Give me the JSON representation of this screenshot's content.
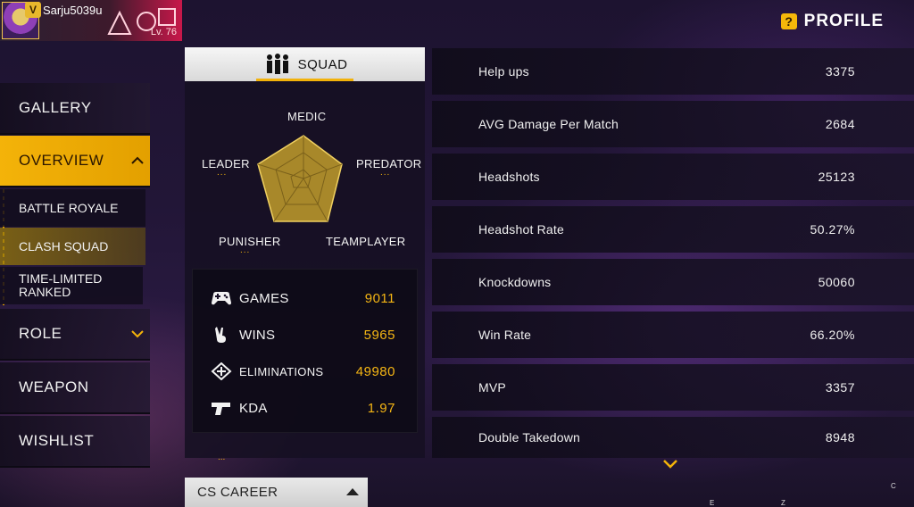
{
  "player": {
    "rank_badge": "V",
    "name": "Sarju5039u",
    "level": "Lv. 76"
  },
  "header": {
    "help_icon": "?",
    "title": "PROFILE"
  },
  "sidebar": {
    "items": [
      {
        "label": "GALLERY"
      },
      {
        "label": "OVERVIEW",
        "active": true
      },
      {
        "label": "ROLE"
      },
      {
        "label": "WEAPON"
      },
      {
        "label": "WISHLIST"
      }
    ],
    "sub_items": [
      {
        "label": "BATTLE ROYALE"
      },
      {
        "label": "CLASH SQUAD",
        "selected": true
      },
      {
        "label": "TIME-LIMITED RANKED"
      }
    ]
  },
  "squad": {
    "tab_label": "SQUAD",
    "radar_labels": {
      "medic": "MEDIC",
      "leader": "LEADER",
      "predator": "PREDATOR",
      "punisher": "PUNISHER",
      "teamplayer": "TEAMPLAYER"
    },
    "placeholder_dots": "...",
    "stats": [
      {
        "icon": "gamepad-icon",
        "label": "GAMES",
        "value": "9011"
      },
      {
        "icon": "victory-hand-icon",
        "label": "WINS",
        "value": "5965"
      },
      {
        "icon": "eliminations-icon",
        "label": "ELIMINATIONS",
        "value": "49980"
      },
      {
        "icon": "pistol-icon",
        "label": "KDA",
        "value": "1.97"
      }
    ]
  },
  "cs_career": {
    "label": "CS CAREER"
  },
  "details": [
    {
      "label": "Help ups",
      "value": "3375"
    },
    {
      "label": "AVG Damage Per Match",
      "value": "2684"
    },
    {
      "label": "Headshots",
      "value": "25123"
    },
    {
      "label": "Headshot Rate",
      "value": "50.27%"
    },
    {
      "label": "Knockdowns",
      "value": "50060"
    },
    {
      "label": "Win Rate",
      "value": "66.20%"
    },
    {
      "label": "MVP",
      "value": "3357"
    },
    {
      "label": "Double Takedown",
      "value": "8948"
    }
  ],
  "corner_letters": {
    "e": "E",
    "z": "Z",
    "c": "C"
  },
  "colors": {
    "accent": "#f4b309",
    "value": "#f5b614",
    "banner": "#c8184a"
  }
}
